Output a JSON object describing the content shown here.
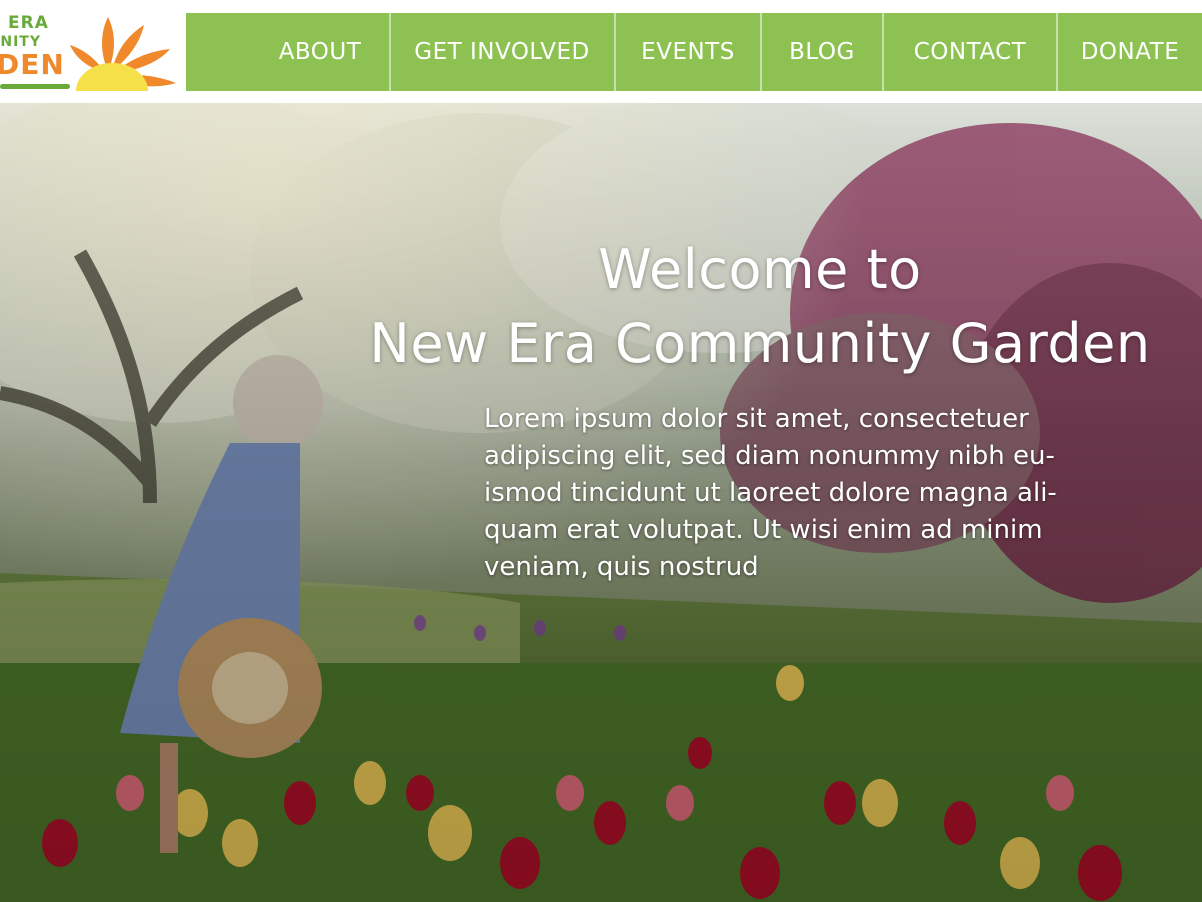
{
  "brand": {
    "logo_line1": "ERA",
    "logo_line2": "UNITY",
    "logo_line3": "DEN",
    "colors": {
      "nav_green": "#8dc252",
      "logo_green": "#6aaa3a",
      "logo_orange": "#f0892c",
      "sun_yellow": "#f6e04a"
    }
  },
  "nav": {
    "items": [
      {
        "label": "ABOUT"
      },
      {
        "label": "GET INVOLVED"
      },
      {
        "label": "EVENTS"
      },
      {
        "label": "BLOG"
      },
      {
        "label": "CONTACT"
      },
      {
        "label": "DONATE"
      }
    ]
  },
  "hero": {
    "title_line1": "Welcome to",
    "title_line2": "New Era Community Garden",
    "body": "Lorem ipsum dolor sit amet, consectetuer\nadipiscing elit, sed diam nonummy nibh eu-\nismod tincidunt ut laoreet dolore magna ali-\nquam erat volutpat. Ut wisi enim ad minim\nveniam, quis nostrud",
    "image_subject": "woman-in-tulip-garden-photo"
  }
}
